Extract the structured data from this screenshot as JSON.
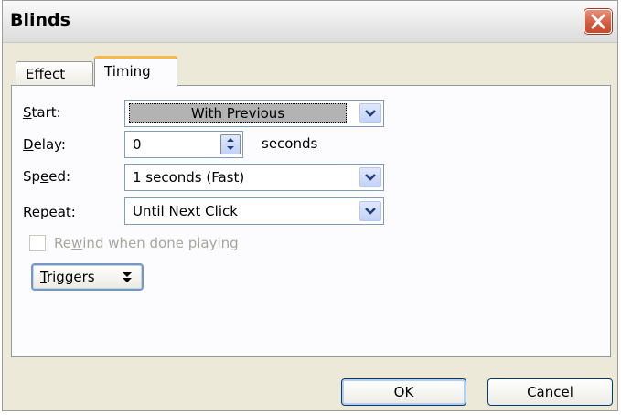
{
  "window": {
    "title": "Blinds",
    "close_icon": "close-icon"
  },
  "tabs": [
    {
      "label": "Effect",
      "active": false
    },
    {
      "label": "Timing",
      "active": true
    }
  ],
  "form": {
    "start": {
      "label_prefix": "",
      "label_accel": "S",
      "label_rest": "tart:",
      "value": "With Previous"
    },
    "delay": {
      "label_accel": "D",
      "label_rest": "elay:",
      "value": "0",
      "unit": "seconds"
    },
    "speed": {
      "label_pre": "Sp",
      "label_accel": "e",
      "label_rest": "ed:",
      "value": "1 seconds (Fast)"
    },
    "repeat": {
      "label_accel": "R",
      "label_rest": "epeat:",
      "value": "Until Next Click"
    },
    "rewind": {
      "label_pre": "Re",
      "label_accel": "w",
      "label_rest": "ind when done playing",
      "checked": false,
      "enabled": false
    }
  },
  "triggers": {
    "label_accel": "T",
    "label_rest": "riggers",
    "icon": "double-chevron-down-icon"
  },
  "buttons": {
    "ok": "OK",
    "cancel": "Cancel"
  },
  "colors": {
    "accent_tab": "#f7b945",
    "close_red": "#d15a3e",
    "dialog_bg": "#ece9d8"
  }
}
